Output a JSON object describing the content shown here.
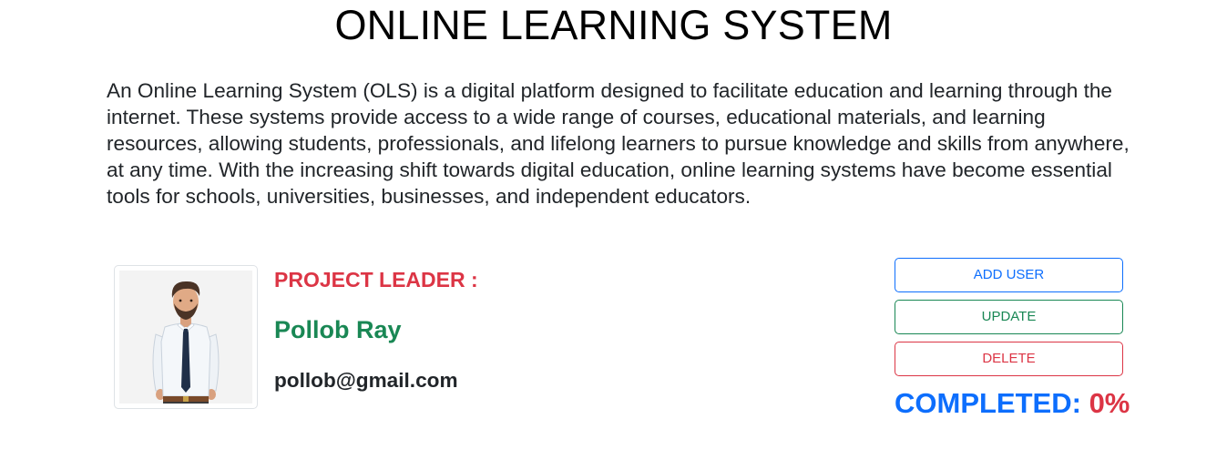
{
  "header": {
    "title": "ONLINE LEARNING SYSTEM"
  },
  "intro": {
    "description": "An Online Learning System (OLS) is a digital platform designed to facilitate education and learning through the internet. These systems provide access to a wide range of courses, educational materials, and learning resources, allowing students, professionals, and lifelong learners to pursue knowledge and skills from anywhere, at any time. With the increasing shift towards digital education, online learning systems have become essential tools for schools, universities, businesses, and independent educators."
  },
  "project_leader": {
    "label": "PROJECT LEADER :",
    "name": "Pollob Ray",
    "email": "pollob@gmail.com",
    "avatar_icon": "person-avatar-illustration"
  },
  "actions": {
    "add_user_label": "ADD USER",
    "update_label": "UPDATE",
    "delete_label": "DELETE"
  },
  "progress": {
    "label": "COMPLETED:",
    "value": "0%"
  },
  "colors": {
    "primary": "#0d6efd",
    "success": "#198754",
    "danger": "#dc3545",
    "text": "#212529"
  }
}
